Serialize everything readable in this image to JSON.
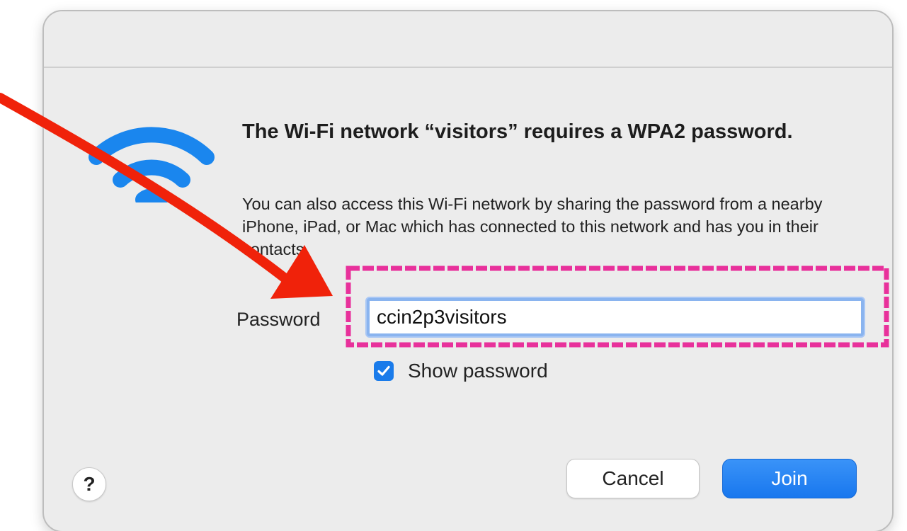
{
  "dialog": {
    "heading": "The Wi-Fi network “visitors” requires a WPA2 password.",
    "body": "You can also access this Wi-Fi network by sharing the password from a nearby iPhone, iPad, or Mac which has connected to this network and has you in their contacts.",
    "icon": "wifi-icon"
  },
  "password": {
    "label": "Password",
    "value": "ccin2p3visitors"
  },
  "show_password": {
    "label": "Show password",
    "checked": true
  },
  "buttons": {
    "help": "?",
    "cancel": "Cancel",
    "join": "Join"
  },
  "colors": {
    "accent": "#1a7bea",
    "wifi": "#1a86ee",
    "annotation_arrow": "#f0220a",
    "annotation_box": "#e8319b"
  }
}
